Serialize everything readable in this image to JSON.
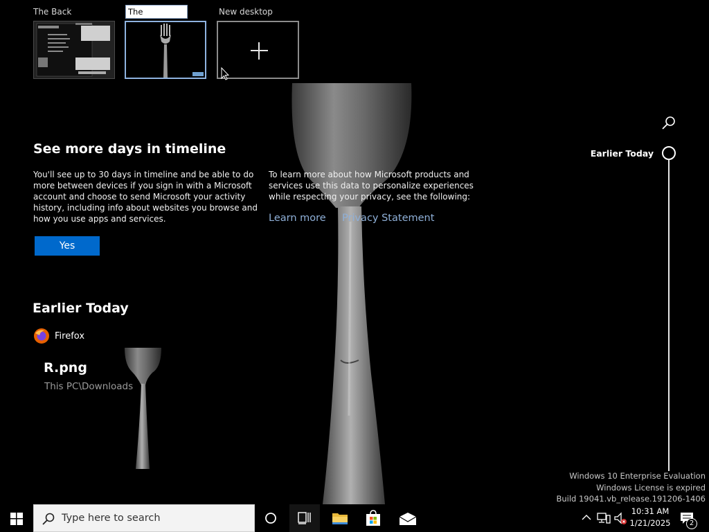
{
  "desktops": {
    "items": [
      {
        "label": "The Back"
      },
      {
        "rename_value": "The "
      },
      {
        "label": "New desktop"
      }
    ]
  },
  "promo": {
    "title": "See more days in timeline",
    "body": "You'll see up to 30 days in timeline and be able to do more between devices if you sign in with a Microsoft account and choose to send Microsoft your activity history, including info about websites you browse and how you use apps and services.",
    "privacy_text": "To learn more about how Microsoft products and services use this data to personalize experiences while respecting your privacy, see the following:",
    "learn_more": "Learn more",
    "privacy_statement": "Privacy Statement",
    "yes_label": "Yes"
  },
  "activity": {
    "section_title": "Earlier Today",
    "app_name": "Firefox",
    "card_title": "R.png",
    "card_path": "This PC\\Downloads"
  },
  "timeline": {
    "node_label": "Earlier Today"
  },
  "watermark": {
    "line1": "Windows 10 Enterprise Evaluation",
    "line2": "Windows License is expired",
    "line3": "Build 19041.vb_release.191206-1406"
  },
  "taskbar": {
    "search_placeholder": "Type here to search",
    "clock_time": "10:31 AM",
    "clock_date": "1/21/2025",
    "notification_count": "2"
  },
  "colors": {
    "accent": "#0069cc",
    "link": "#8fb0d8",
    "background": "#000000"
  }
}
